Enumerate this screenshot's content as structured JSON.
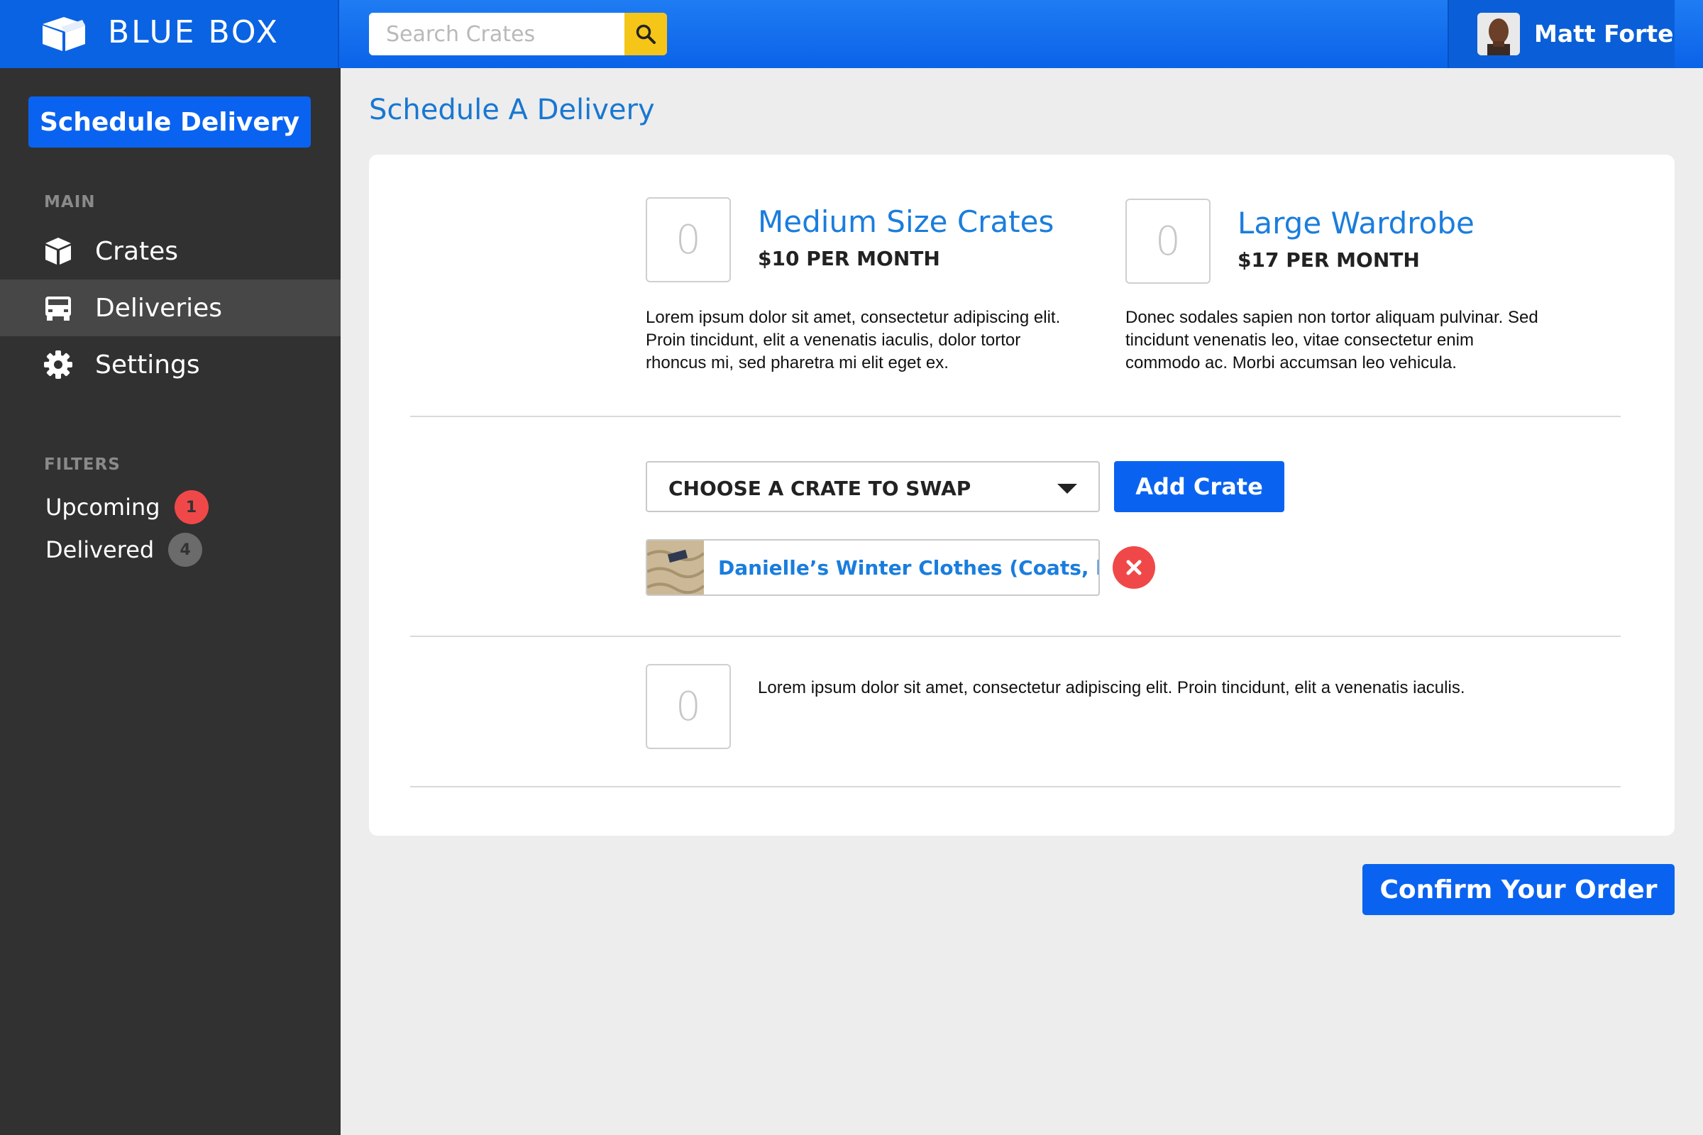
{
  "brand": {
    "name": "BLUE BOX",
    "logo_icon": "box-icon"
  },
  "search": {
    "placeholder": "Search Crates",
    "icon": "search-icon",
    "accent": "#f5c518"
  },
  "user": {
    "name": "Matt Forte"
  },
  "sidebar": {
    "cta_label": "Schedule Delivery",
    "main_label": "MAIN",
    "items": [
      {
        "label": "Crates",
        "icon": "cube-icon",
        "active": false
      },
      {
        "label": "Deliveries",
        "icon": "truck-icon",
        "active": true
      },
      {
        "label": "Settings",
        "icon": "gear-icon",
        "active": false
      }
    ],
    "filters_label": "FILTERS",
    "filters": [
      {
        "label": "Upcoming",
        "count": "1",
        "color": "#f04848"
      },
      {
        "label": "Delivered",
        "count": "4",
        "color": "#6b6b6b"
      }
    ]
  },
  "page": {
    "title": "Schedule A Delivery"
  },
  "products": [
    {
      "qty": "0",
      "name": "Medium Size Crates",
      "price": "$10 PER MONTH",
      "description": "Lorem ipsum dolor sit amet, consectetur adipiscing elit. Proin tincidunt, elit a venenatis iaculis, dolor tortor rhoncus mi, sed pharetra mi elit eget ex."
    },
    {
      "qty": "0",
      "name": "Large Wardrobe",
      "price": "$17 PER MONTH",
      "description": "Donec sodales sapien non tortor aliquam pulvinar. Sed tincidunt venenatis leo, vitae consectetur enim commodo ac. Morbi accumsan leo vehicula."
    }
  ],
  "swap": {
    "select_label": "CHOOSE A CRATE TO SWAP",
    "add_label": "Add Crate",
    "selected_crate": "Danielle’s  Winter Clothes (Coats, long..."
  },
  "extra": {
    "qty": "0",
    "description": "Lorem ipsum dolor sit amet, consectetur adipiscing elit. Proin tincidunt, elit a venenatis iaculis."
  },
  "confirm_label": "Confirm Your Order",
  "colors": {
    "primary": "#0a63f0",
    "link": "#1a7ddd",
    "sidebar": "#313131",
    "danger": "#f04848"
  }
}
